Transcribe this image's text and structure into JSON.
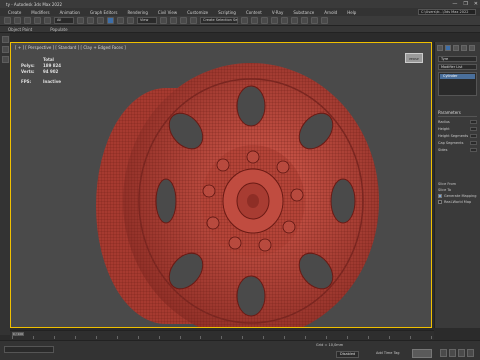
{
  "window": {
    "title": "ty - Autodesk 3ds Max 2022",
    "controls": [
      "—",
      "❐",
      "✕"
    ]
  },
  "menu": {
    "items": [
      "Create",
      "Modifiers",
      "Animation",
      "Graph Editors",
      "Rendering",
      "Civil View",
      "Customize",
      "Scripting",
      "Content",
      "V-Ray",
      "Substance",
      "Arnold",
      "Help"
    ],
    "workspace": "C:\\Users\\tr...\\3ds Max 2022"
  },
  "toolbar": {
    "view_dropdown": "View",
    "selection_set": "Create Selection Se"
  },
  "ribbon": {
    "items": [
      "Object Paint",
      "Populate"
    ]
  },
  "viewport": {
    "label": "[ + ] [ Perspective ] [ Standard ] [ Clay + Edged Faces ]",
    "stats": {
      "header": "Total",
      "polys_label": "Polys:",
      "polys_value": "189 824",
      "verts_label": "Verts:",
      "verts_value": "94 902",
      "fps_label": "FPS:",
      "fps_value": "Inactive"
    },
    "mesh_color": "#c0483c",
    "wire_color": "#5a1410"
  },
  "command_panel": {
    "object_name": "Tyre",
    "modifier_list": "Modifier List",
    "stack_item": "Cylinder",
    "section_title": "Parameters",
    "params": [
      "Radius",
      "Height",
      "Height Segments",
      "Cap Segments",
      "Sides"
    ],
    "checkboxes": [
      "Slice From",
      "Slice To",
      "Generate Mapping",
      "Real-World Map"
    ],
    "checkbox_states": [
      false,
      false,
      true,
      false
    ]
  },
  "status": {
    "grid": "Grid = 10,0mm",
    "add_time_tag": "Add Time Tag",
    "mode": "Disabled"
  }
}
